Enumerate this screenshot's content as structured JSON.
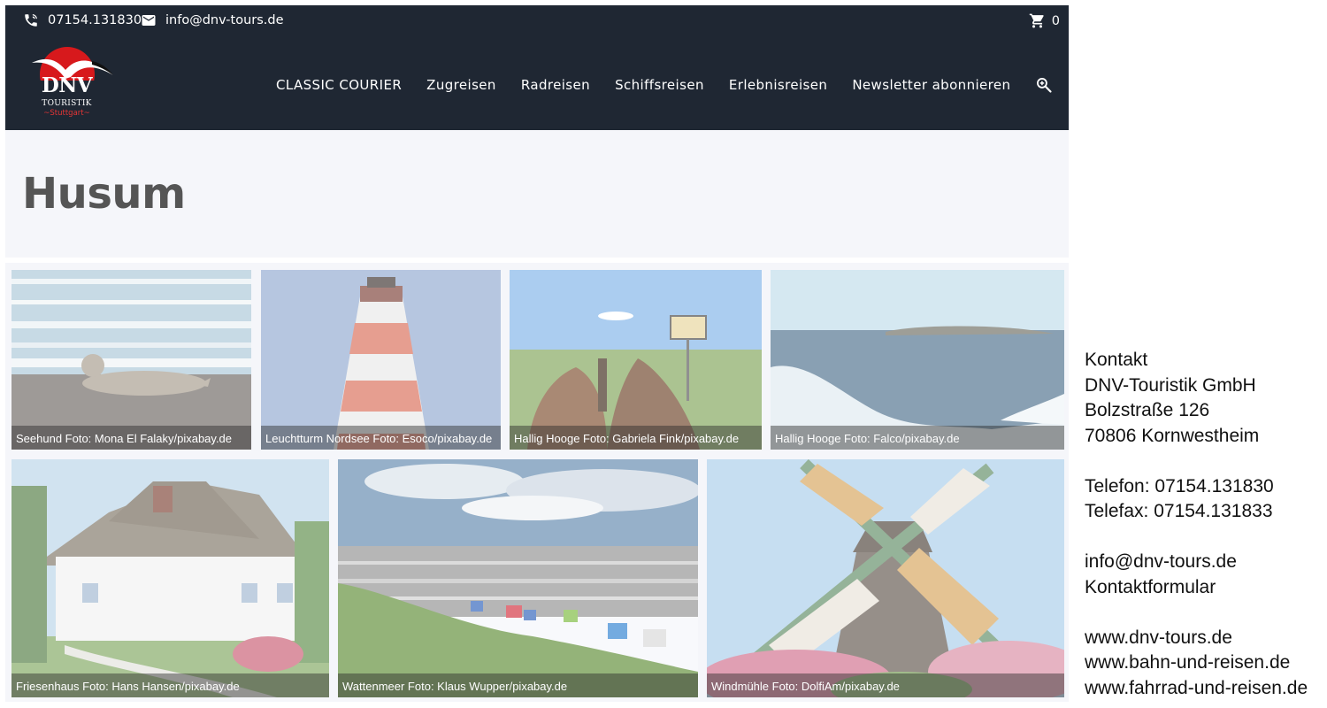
{
  "topbar": {
    "phone": "07154.131830",
    "email": "info@dnv-tours.de",
    "cart_count": "0"
  },
  "logo": {
    "brand": "DNV",
    "sub": "TOURISTIK",
    "city": "~Stuttgart~"
  },
  "nav": {
    "items": [
      {
        "label": "CLASSIC COURIER"
      },
      {
        "label": "Zugreisen"
      },
      {
        "label": "Radreisen"
      },
      {
        "label": "Schiffsreisen"
      },
      {
        "label": "Erlebnisreisen"
      },
      {
        "label": "Newsletter abonnieren"
      }
    ]
  },
  "page": {
    "title": "Husum"
  },
  "gallery": {
    "images": [
      {
        "caption": "Seehund Foto: Mona El Falaky/pixabay.de",
        "icon": "seal-photo"
      },
      {
        "caption": "Leuchtturm Nordsee Foto: Esoco/pixabay.de",
        "icon": "lighthouse-photo"
      },
      {
        "caption": "Hallig Hooge Foto: Gabriela Fink/pixabay.de",
        "icon": "horses-photo"
      },
      {
        "caption": "Hallig Hooge Foto: Falco/pixabay.de",
        "icon": "sea-photo"
      },
      {
        "caption": "Friesenhaus Foto: Hans Hansen/pixabay.de",
        "icon": "house-photo"
      },
      {
        "caption": "Wattenmeer Foto: Klaus Wupper/pixabay.de",
        "icon": "beach-photo"
      },
      {
        "caption": "Windmühle Foto: DolfiAm/pixabay.de",
        "icon": "windmill-photo"
      }
    ]
  },
  "sidebar": {
    "heading": "Kontakt",
    "company": "DNV-Touristik GmbH",
    "street": "Bolzstraße 126",
    "city": "70806 Kornwestheim",
    "phone": "Telefon: 07154.131830",
    "fax": "Telefax: 07154.131833",
    "email": "info@dnv-tours.de",
    "form_link": "Kontaktformular",
    "links": [
      "www.dnv-tours.de",
      "www.bahn-und-reisen.de",
      "www.fahrrad-und-reisen.de"
    ]
  },
  "colors": {
    "header_bg": "#1f2733",
    "title_band_bg": "#f5f6fa",
    "logo_red": "#d7191c",
    "title_text": "#555555"
  }
}
